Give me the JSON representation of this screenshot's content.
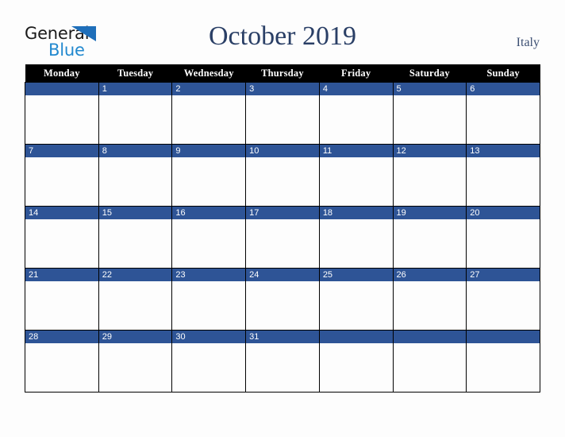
{
  "brand": {
    "name_part1": "General",
    "name_part2": "Blue",
    "triangle_color": "#1f6fba",
    "blue_color": "#2289cf"
  },
  "header": {
    "title": "October 2019",
    "country": "Italy",
    "title_color": "#2a3f66"
  },
  "calendar": {
    "month": "October",
    "year": "2019",
    "weekday_headers": [
      "Monday",
      "Tuesday",
      "Wednesday",
      "Thursday",
      "Friday",
      "Saturday",
      "Sunday"
    ],
    "header_bg": "#000000",
    "header_text_color": "#ffffff",
    "daynum_bg": "#2e5496",
    "daynum_text_color": "#ffffff",
    "cell_bg": "#fdfdfd",
    "border_color": "#000000",
    "weeks": [
      [
        {
          "day": ""
        },
        {
          "day": "1"
        },
        {
          "day": "2"
        },
        {
          "day": "3"
        },
        {
          "day": "4"
        },
        {
          "day": "5"
        },
        {
          "day": "6"
        }
      ],
      [
        {
          "day": "7"
        },
        {
          "day": "8"
        },
        {
          "day": "9"
        },
        {
          "day": "10"
        },
        {
          "day": "11"
        },
        {
          "day": "12"
        },
        {
          "day": "13"
        }
      ],
      [
        {
          "day": "14"
        },
        {
          "day": "15"
        },
        {
          "day": "16"
        },
        {
          "day": "17"
        },
        {
          "day": "18"
        },
        {
          "day": "19"
        },
        {
          "day": "20"
        }
      ],
      [
        {
          "day": "21"
        },
        {
          "day": "22"
        },
        {
          "day": "23"
        },
        {
          "day": "24"
        },
        {
          "day": "25"
        },
        {
          "day": "26"
        },
        {
          "day": "27"
        }
      ],
      [
        {
          "day": "28"
        },
        {
          "day": "29"
        },
        {
          "day": "30"
        },
        {
          "day": "31"
        },
        {
          "day": ""
        },
        {
          "day": ""
        },
        {
          "day": ""
        }
      ]
    ]
  }
}
